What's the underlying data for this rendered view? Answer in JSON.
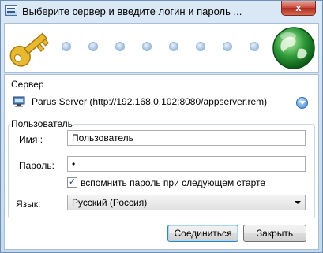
{
  "window": {
    "title": "Выберите сервер и введите логин и пароль ...",
    "close_label": "x"
  },
  "banner": {
    "steps": 10,
    "icons": [
      "key-icon",
      "globe-icon"
    ]
  },
  "server": {
    "legend": "Сервер",
    "value": "Parus Server (http://192.168.0.102:8080/appserver.rem)"
  },
  "user": {
    "legend": "Пользователь",
    "name_label": "Имя :",
    "name_value": "Пользователь",
    "password_label": "Пароль:",
    "password_value": "•",
    "remember_label": "вспомнить пароль при следующем старте",
    "remember_checked": true
  },
  "language": {
    "label": "Язык:",
    "value": "Русский (Россия)"
  },
  "buttons": {
    "connect": "Соединиться",
    "close": "Закрыть"
  },
  "colors": {
    "accent": "#3c7fb1",
    "key": "#e8b830",
    "globe": "#2f9a3a"
  }
}
